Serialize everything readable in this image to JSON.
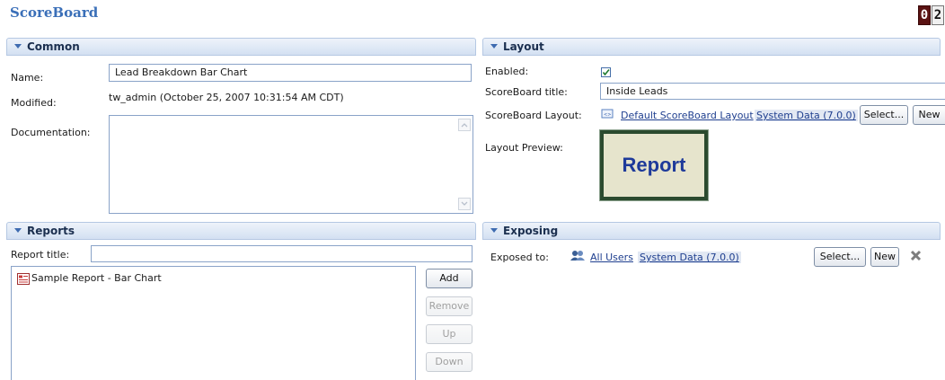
{
  "page": {
    "title": "ScoreBoard",
    "counter": [
      "0",
      "2"
    ]
  },
  "common": {
    "header": "Common",
    "name_label": "Name:",
    "name_value": "Lead Breakdown Bar Chart",
    "modified_label": "Modified:",
    "modified_value": "tw_admin (October 25, 2007 10:31:54 AM CDT)",
    "documentation_label": "Documentation:",
    "documentation_value": ""
  },
  "layout": {
    "header": "Layout",
    "enabled_label": "Enabled:",
    "enabled_checked": true,
    "title_label": "ScoreBoard title:",
    "title_value": "Inside Leads",
    "layout_label": "ScoreBoard Layout:",
    "layout_link": "Default ScoreBoard Layout",
    "layout_source": "System Data (7.0.0)",
    "select_label": "Select...",
    "new_label": "New",
    "preview_label": "Layout Preview:",
    "preview_text": "Report"
  },
  "reports": {
    "header": "Reports",
    "title_label": "Report title:",
    "title_value": "",
    "items": [
      "Sample Report - Bar Chart"
    ],
    "buttons": {
      "add": "Add",
      "remove": "Remove",
      "up": "Up",
      "down": "Down"
    }
  },
  "exposing": {
    "header": "Exposing",
    "exposed_label": "Exposed to:",
    "link": "All Users",
    "source": "System Data (7.0.0)",
    "select_label": "Select...",
    "new_label": "New"
  },
  "colors": {
    "accent": "#3a6fb8",
    "section_bg": "#d3e0f2",
    "link": "#1f3f8f"
  },
  "icons": [
    "triangle-down-icon",
    "checkmark-icon",
    "layout-file-icon",
    "users-icon",
    "report-icon",
    "delete-x-icon"
  ]
}
